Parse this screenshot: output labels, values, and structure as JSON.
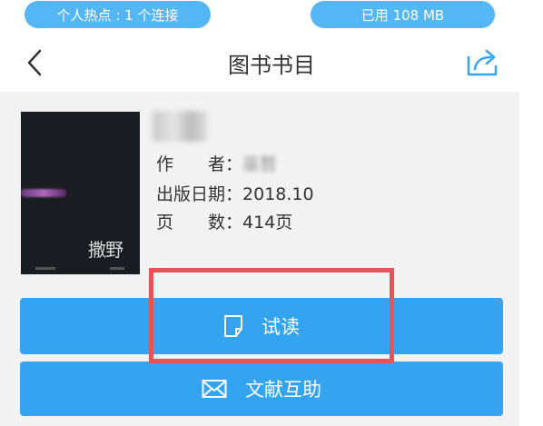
{
  "status": {
    "hotspot": "个人热点 : 1 个连接",
    "storage": "已用 108 MB"
  },
  "nav": {
    "title": "图书书目"
  },
  "book": {
    "title": "撒野",
    "author_label": "作　　者：",
    "author_value": "巫哲",
    "date_label": "出版日期：",
    "date_value": "2018.10",
    "pages_label": "页　　数：",
    "pages_value": "414页",
    "cover_text": "撒野"
  },
  "actions": {
    "read_label": "试读",
    "help_label": "文献互助"
  },
  "icons": {
    "back": "chevron-left-icon",
    "share": "share-icon",
    "read": "document-icon",
    "help": "envelope-icon"
  },
  "colors": {
    "accent": "#34a4f0",
    "highlight": "#e2565a"
  }
}
